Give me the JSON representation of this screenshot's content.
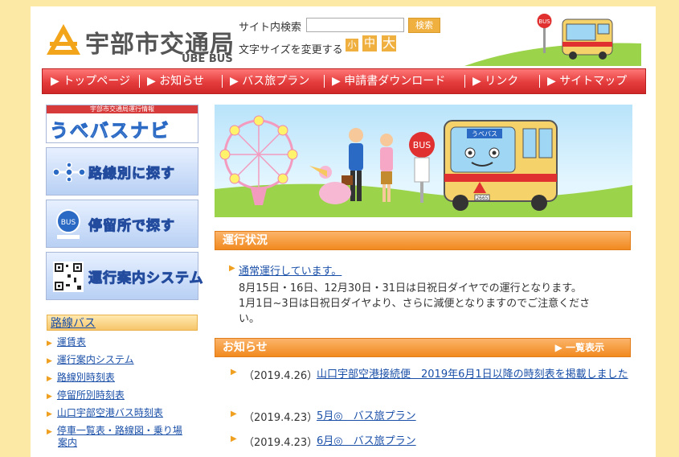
{
  "header": {
    "logo_title": "宇部市交通局",
    "logo_sub": "UBE BUS",
    "search_label": "サイト内検索",
    "search_button": "検索",
    "search_value": "",
    "fontsize_label": "文字サイズを変更する",
    "fontsize_small": "小",
    "fontsize_medium": "中",
    "fontsize_large": "大",
    "bus_stop_sign": "BUS"
  },
  "nav": [
    {
      "label": "トップページ"
    },
    {
      "label": "お知らせ"
    },
    {
      "label": "バス旅プラン"
    },
    {
      "label": "申請書ダウンロード"
    },
    {
      "label": "リンク"
    },
    {
      "label": "サイトマップ"
    }
  ],
  "sidebar": {
    "navi_top": "宇部市交通局運行情報",
    "navi_main": "うべバスナビ",
    "route_search": "路線別に探す",
    "stop_search": "停留所で探す",
    "guide_system": "運行案内システム",
    "bus_icon_label": "BUS",
    "section_title": "路線バス",
    "items": [
      "運賃表",
      "運行案内システム",
      "路線別時刻表",
      "停留所別時刻表",
      "山口宇部空港バス時刻表",
      "停車一覧表・路線図・乗り場",
      "案内"
    ]
  },
  "hero": {
    "bus_sign": "BUS",
    "bus_destination": "うべバス",
    "bus_number": "2665"
  },
  "status": {
    "title": "運行状況",
    "link": "通常運行しています。",
    "lines": [
      "8月15日・16日、12月30日・31日は日祝日ダイヤでの運行となります。",
      "1月1日~3日は日祝日ダイヤより、さらに減便となりますのでご注意くださ",
      "い。"
    ]
  },
  "news": {
    "title": "お知らせ",
    "more": "一覧表示",
    "items": [
      {
        "date": "（2019.4.26）",
        "text": "山口宇部空港接続便　2019年6月1日以降の時刻表を掲載しました"
      },
      {
        "date": "（2019.4.23）",
        "text": "5月◎　バス旅プラン"
      },
      {
        "date": "（2019.4.23）",
        "text": "6月◎　バス旅プラン"
      }
    ]
  },
  "colors": {
    "background": "#fde9a6",
    "nav_red": "#e43c3c",
    "accent_orange": "#f18a1f",
    "link_blue": "#1a4fa8"
  }
}
